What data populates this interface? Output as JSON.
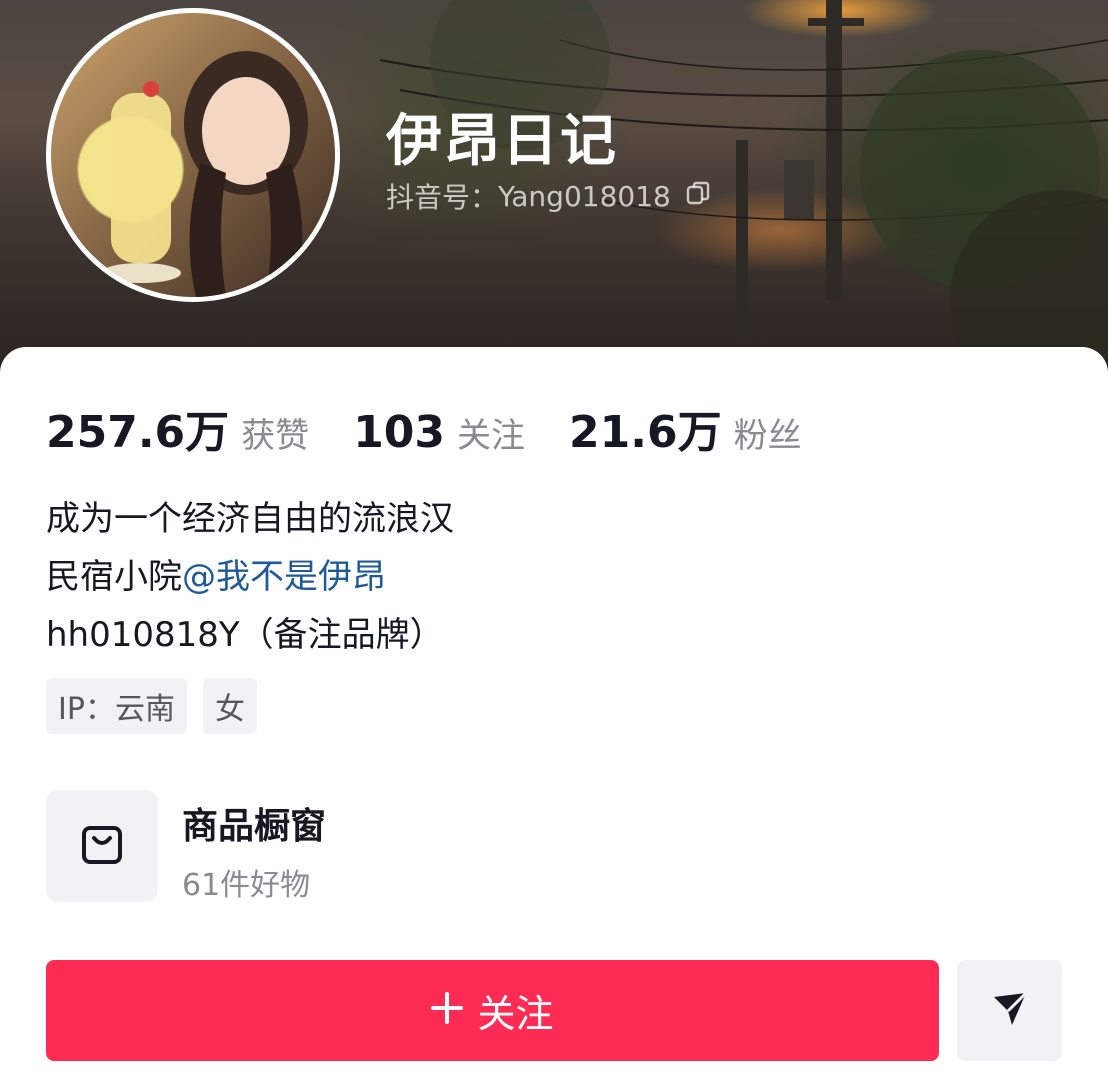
{
  "profile": {
    "name": "伊昂日记",
    "account_label": "抖音号：",
    "account_id": "Yang018018"
  },
  "stats": {
    "likes_value": "257.6万",
    "likes_label": "获赞",
    "following_value": "103",
    "following_label": "关注",
    "followers_value": "21.6万",
    "followers_label": "粉丝"
  },
  "bio": {
    "line1": "成为一个经济自由的流浪汉",
    "line2_prefix": "民宿小院",
    "line2_mention": "@我不是伊昂",
    "line3": "hh010818Y（备注品牌）"
  },
  "tags": {
    "ip": "IP：云南",
    "gender": "女"
  },
  "shop": {
    "title": "商品橱窗",
    "subtitle": "61件好物"
  },
  "actions": {
    "follow_label": "关注"
  },
  "colors": {
    "accent": "#fe2c55",
    "mention": "#1f5a96"
  },
  "icons": [
    "copy-icon",
    "shopping-bag-icon",
    "plus-icon",
    "send-icon"
  ]
}
